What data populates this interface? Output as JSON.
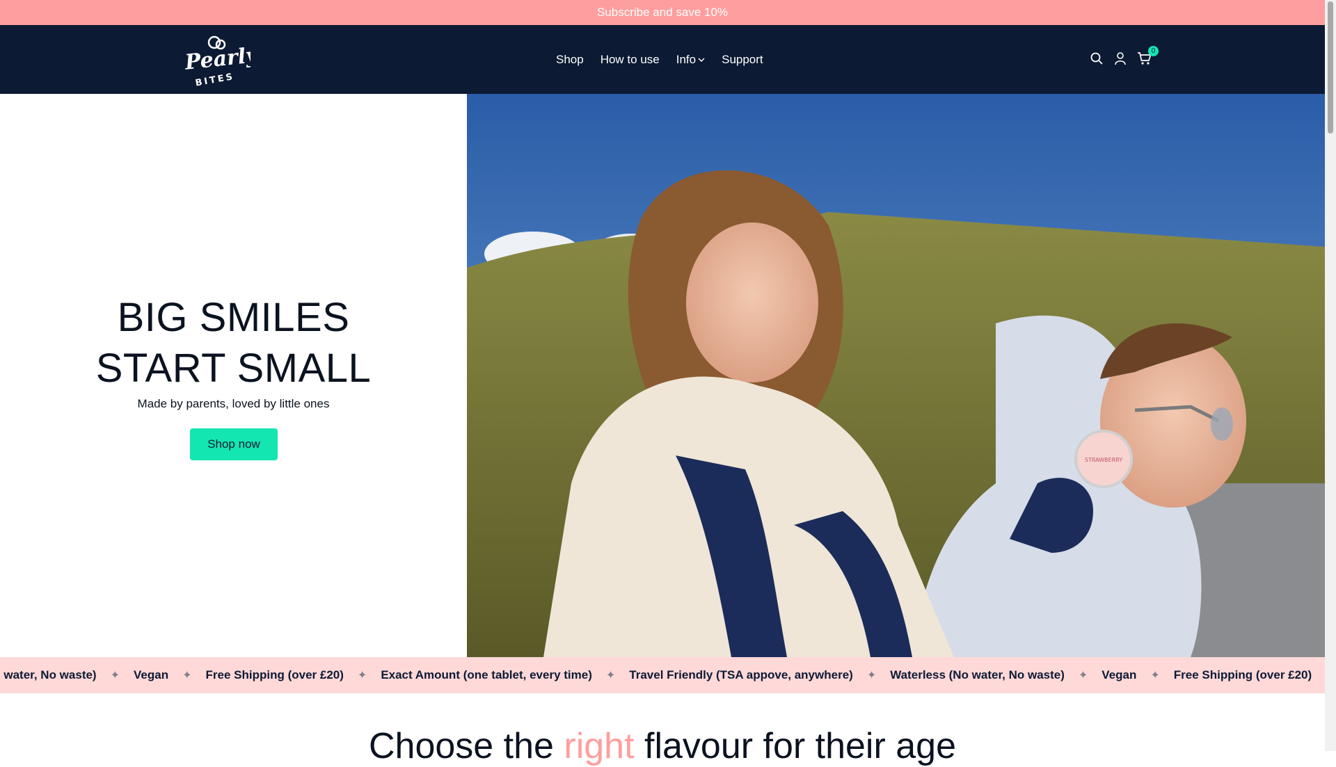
{
  "announcement": {
    "text": "Subscribe and save 10%"
  },
  "brand": {
    "logo_line1": "Pearly",
    "logo_line2": "BITES",
    "accent": "#14e6b2",
    "navy": "#0c1a33",
    "pink": "#ff9e9e"
  },
  "nav": {
    "items": [
      {
        "label": "Shop"
      },
      {
        "label": "How to use"
      },
      {
        "label": "Info"
      },
      {
        "label": "Support"
      }
    ]
  },
  "header_icons": {
    "search": "search-icon",
    "account": "account-icon",
    "cart": "cart-icon",
    "cart_count": "0"
  },
  "hero": {
    "title_line1": "BIG SMILES",
    "title_line2": "START SMALL",
    "subtitle": "Made by parents, loved by little ones",
    "button_label": "Shop now",
    "image_label": "STRAWBERRY"
  },
  "marquee": {
    "items": [
      "No water, No waste)",
      "Vegan",
      "Free Shipping (over £20)",
      "Exact Amount (one tablet, every time)",
      "Travel Friendly (TSA appove, anywhere)",
      "Waterless (No water, No waste)",
      "Vegan",
      "Free Shipping (over £20)"
    ]
  },
  "section": {
    "title_before": "Choose the ",
    "title_accent": "right",
    "title_after": " flavour for their age"
  }
}
